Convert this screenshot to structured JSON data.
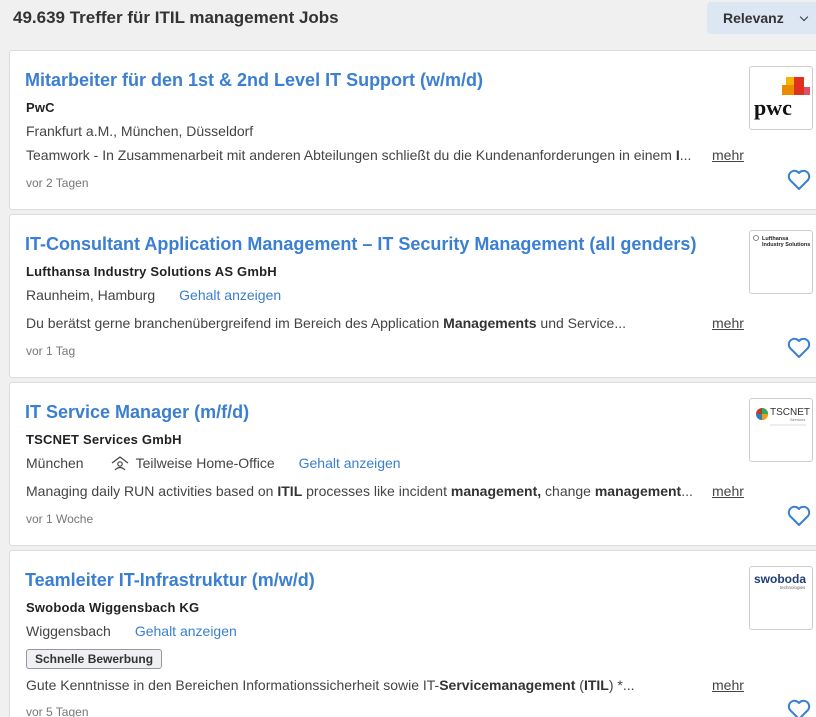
{
  "header": {
    "result_title": "49.639 Treffer für ITIL management Jobs",
    "sort_label": "Relevanz"
  },
  "colors": {
    "accent": "#3a7fd1",
    "sort_bg": "#dde6f3"
  },
  "jobs": [
    {
      "title": "Mitarbeiter für den 1st & 2nd Level IT Support (w/m/d)",
      "company": "PwC",
      "location": "Frankfurt a.M., München, Düsseldorf",
      "desc_parts": [
        "Teamwork - In Zusammenarbeit mit anderen Abteilungen schließt du die Kundenanforderungen in einem ",
        "I",
        "..."
      ],
      "more": "mehr",
      "age": "vor 2 Tagen",
      "logo_icon": "pwc-logo",
      "logo_text": "pwc"
    },
    {
      "title": "IT-Consultant Application Management – IT Security Management (all genders)",
      "company": "Lufthansa Industry Solutions AS GmbH",
      "location": "Raunheim, Hamburg",
      "salary": "Gehalt anzeigen",
      "desc_parts": [
        "Du berätst gerne branchenübergreifend im Bereich des Application ",
        "Managements",
        " und Service..."
      ],
      "more": "mehr",
      "age": "vor 1 Tag",
      "logo_icon": "lufthansa-industry-solutions-logo",
      "logo_text_1": "Lufthansa",
      "logo_text_2": "Industry Solutions"
    },
    {
      "title": "IT Service Manager (m/f/d)",
      "company": "TSCNET Services GmbH",
      "location": "München",
      "homeoffice": "Teilweise Home-Office",
      "salary": "Gehalt anzeigen",
      "desc_parts": [
        "Managing daily RUN activities based on ",
        "ITIL",
        " processes like incident ",
        "management,",
        " change ",
        "management",
        "..."
      ],
      "more": "mehr",
      "age": "vor 1 Woche",
      "logo_icon": "tscnet-logo",
      "logo_text_1": "TSCNET",
      "logo_text_2": "Services"
    },
    {
      "title": "Teamleiter IT-Infrastruktur (m/w/d)",
      "company": "Swoboda Wiggensbach KG",
      "location": "Wiggensbach",
      "salary": "Gehalt anzeigen",
      "badge": "Schnelle Bewerbung",
      "desc_parts": [
        "Gute Kenntnisse in den Bereichen Informationssicherheit sowie IT-",
        "Servicemanagement",
        " (",
        "ITIL",
        ") *..."
      ],
      "more": "mehr",
      "age": "vor 5 Tagen",
      "logo_icon": "swoboda-logo",
      "logo_text_1": "swoboda",
      "logo_text_2": "technologies"
    }
  ]
}
